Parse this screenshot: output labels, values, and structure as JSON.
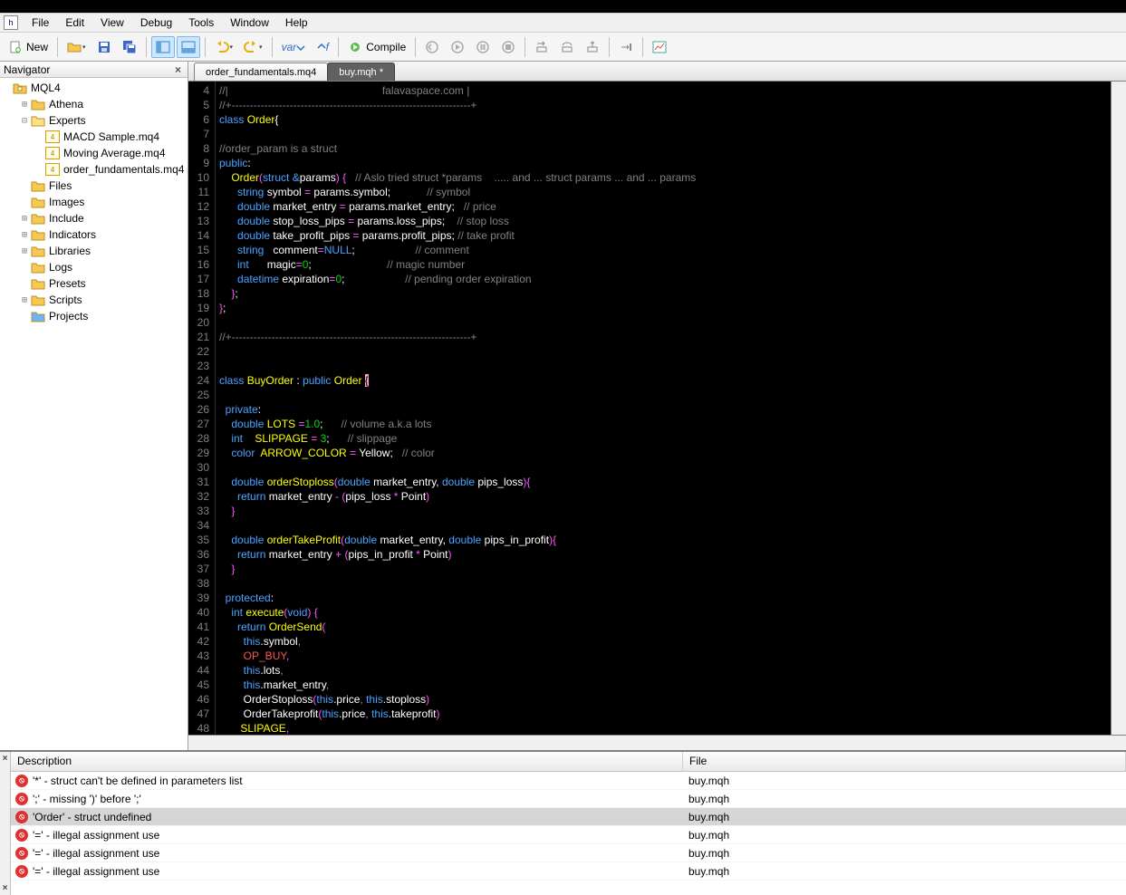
{
  "menu": {
    "items": [
      "File",
      "Edit",
      "View",
      "Debug",
      "Tools",
      "Window",
      "Help"
    ]
  },
  "toolbar": {
    "new_label": "New",
    "compile_label": "Compile",
    "var_label": "var",
    "f_label": "f"
  },
  "navigator": {
    "title": "Navigator",
    "root": "MQL4",
    "nodes": [
      {
        "label": "Athena",
        "depth": 1,
        "expander": "+",
        "icon": "folder"
      },
      {
        "label": "Experts",
        "depth": 1,
        "expander": "-",
        "icon": "folder-open"
      },
      {
        "label": "MACD Sample.mq4",
        "depth": 2,
        "expander": "",
        "icon": "mq4"
      },
      {
        "label": "Moving Average.mq4",
        "depth": 2,
        "expander": "",
        "icon": "mq4"
      },
      {
        "label": "order_fundamentals.mq4",
        "depth": 2,
        "expander": "",
        "icon": "mq4"
      },
      {
        "label": "Files",
        "depth": 1,
        "expander": "",
        "icon": "folder"
      },
      {
        "label": "Images",
        "depth": 1,
        "expander": "",
        "icon": "folder"
      },
      {
        "label": "Include",
        "depth": 1,
        "expander": "+",
        "icon": "folder"
      },
      {
        "label": "Indicators",
        "depth": 1,
        "expander": "+",
        "icon": "folder"
      },
      {
        "label": "Libraries",
        "depth": 1,
        "expander": "+",
        "icon": "folder"
      },
      {
        "label": "Logs",
        "depth": 1,
        "expander": "",
        "icon": "folder"
      },
      {
        "label": "Presets",
        "depth": 1,
        "expander": "",
        "icon": "folder"
      },
      {
        "label": "Scripts",
        "depth": 1,
        "expander": "+",
        "icon": "folder"
      },
      {
        "label": "Projects",
        "depth": 1,
        "expander": "",
        "icon": "folder-blue"
      }
    ]
  },
  "tabs": [
    {
      "label": "order_fundamentals.mq4",
      "active": false
    },
    {
      "label": "buy.mqh *",
      "active": true
    }
  ],
  "gutter_start": 4,
  "gutter_end": 48,
  "code_lines": [
    [
      [
        "gray",
        "//|                                                   falavaspace.com |"
      ]
    ],
    [
      [
        "gray",
        "//+------------------------------------------------------------------+"
      ]
    ],
    [
      [
        "blue",
        "class"
      ],
      [
        "white",
        " "
      ],
      [
        "yellow",
        "Order"
      ],
      [
        "white",
        "{"
      ]
    ],
    [],
    [
      [
        "gray",
        "//order_param is a struct"
      ]
    ],
    [
      [
        "blue",
        "public"
      ],
      [
        "white",
        ":"
      ]
    ],
    [
      [
        "white",
        "    "
      ],
      [
        "yellow",
        "Order"
      ],
      [
        "magenta",
        "("
      ],
      [
        "blue",
        "struct"
      ],
      [
        "white",
        " "
      ],
      [
        "blue",
        "&"
      ],
      [
        "white",
        "params"
      ],
      [
        "magenta",
        ")"
      ],
      [
        "white",
        " "
      ],
      [
        "magenta",
        "{"
      ],
      [
        "white",
        "   "
      ],
      [
        "gray",
        "// Aslo tried struct *params    ..... and ... struct params ... and ... params"
      ]
    ],
    [
      [
        "white",
        "      "
      ],
      [
        "blue",
        "string"
      ],
      [
        "white",
        " symbol "
      ],
      [
        "magenta",
        "="
      ],
      [
        "white",
        " params.symbol;            "
      ],
      [
        "gray",
        "// symbol"
      ]
    ],
    [
      [
        "white",
        "      "
      ],
      [
        "blue",
        "double"
      ],
      [
        "white",
        " market_entry "
      ],
      [
        "magenta",
        "="
      ],
      [
        "white",
        " params.market_entry;   "
      ],
      [
        "gray",
        "// price"
      ]
    ],
    [
      [
        "white",
        "      "
      ],
      [
        "blue",
        "double"
      ],
      [
        "white",
        " stop_loss_pips "
      ],
      [
        "magenta",
        "="
      ],
      [
        "white",
        " params.loss_pips;    "
      ],
      [
        "gray",
        "// stop loss"
      ]
    ],
    [
      [
        "white",
        "      "
      ],
      [
        "blue",
        "double"
      ],
      [
        "white",
        " take_profit_pips "
      ],
      [
        "magenta",
        "="
      ],
      [
        "white",
        " params.profit_pips; "
      ],
      [
        "gray",
        "// take profit"
      ]
    ],
    [
      [
        "white",
        "      "
      ],
      [
        "blue",
        "string"
      ],
      [
        "white",
        "   comment"
      ],
      [
        "magenta",
        "="
      ],
      [
        "blue",
        "NULL"
      ],
      [
        "white",
        ";                    "
      ],
      [
        "gray",
        "// comment"
      ]
    ],
    [
      [
        "white",
        "      "
      ],
      [
        "blue",
        "int"
      ],
      [
        "white",
        "      magic"
      ],
      [
        "magenta",
        "="
      ],
      [
        "green",
        "0"
      ],
      [
        "white",
        ";                         "
      ],
      [
        "gray",
        "// magic number"
      ]
    ],
    [
      [
        "white",
        "      "
      ],
      [
        "blue",
        "datetime"
      ],
      [
        "white",
        " expiration"
      ],
      [
        "magenta",
        "="
      ],
      [
        "green",
        "0"
      ],
      [
        "white",
        ";                    "
      ],
      [
        "gray",
        "// pending order expiration"
      ]
    ],
    [
      [
        "white",
        "    "
      ],
      [
        "magenta",
        "}"
      ],
      [
        "white",
        ";"
      ]
    ],
    [
      [
        "magenta",
        "}"
      ],
      [
        "white",
        ";"
      ]
    ],
    [],
    [
      [
        "gray",
        "//+------------------------------------------------------------------+"
      ]
    ],
    [],
    [],
    [
      [
        "blue",
        "class"
      ],
      [
        "white",
        " "
      ],
      [
        "yellow",
        "BuyOrder"
      ],
      [
        "white",
        " : "
      ],
      [
        "blue",
        "public"
      ],
      [
        "white",
        " "
      ],
      [
        "yellow",
        "Order"
      ],
      [
        "white",
        " "
      ],
      [
        "cursor",
        "{"
      ]
    ],
    [],
    [
      [
        "white",
        "  "
      ],
      [
        "blue",
        "private"
      ],
      [
        "white",
        ":"
      ]
    ],
    [
      [
        "white",
        "    "
      ],
      [
        "blue",
        "double"
      ],
      [
        "white",
        " "
      ],
      [
        "yellow",
        "LOTS"
      ],
      [
        "white",
        " "
      ],
      [
        "magenta",
        "="
      ],
      [
        "green",
        "1.0"
      ],
      [
        "white",
        ";      "
      ],
      [
        "gray",
        "// volume a.k.a lots"
      ]
    ],
    [
      [
        "white",
        "    "
      ],
      [
        "blue",
        "int"
      ],
      [
        "white",
        "    "
      ],
      [
        "yellow",
        "SLIPPAGE"
      ],
      [
        "white",
        " "
      ],
      [
        "magenta",
        "="
      ],
      [
        "white",
        " "
      ],
      [
        "green",
        "3"
      ],
      [
        "white",
        ";      "
      ],
      [
        "gray",
        "// slippage"
      ]
    ],
    [
      [
        "white",
        "    "
      ],
      [
        "blue",
        "color"
      ],
      [
        "white",
        "  "
      ],
      [
        "yellow",
        "ARROW_COLOR"
      ],
      [
        "white",
        " "
      ],
      [
        "magenta",
        "="
      ],
      [
        "white",
        " Yellow;   "
      ],
      [
        "gray",
        "// color"
      ]
    ],
    [],
    [
      [
        "white",
        "    "
      ],
      [
        "blue",
        "double"
      ],
      [
        "white",
        " "
      ],
      [
        "yellow",
        "orderStoploss"
      ],
      [
        "magenta",
        "("
      ],
      [
        "blue",
        "double"
      ],
      [
        "white",
        " market_entry, "
      ],
      [
        "blue",
        "double"
      ],
      [
        "white",
        " pips_loss"
      ],
      [
        "magenta",
        ")"
      ],
      [
        "magenta",
        "{"
      ]
    ],
    [
      [
        "white",
        "      "
      ],
      [
        "blue",
        "return"
      ],
      [
        "white",
        " market_entry "
      ],
      [
        "magenta",
        "-"
      ],
      [
        "white",
        " "
      ],
      [
        "magenta",
        "("
      ],
      [
        "white",
        "pips_loss "
      ],
      [
        "magenta",
        "*"
      ],
      [
        "white",
        " Point"
      ],
      [
        "magenta",
        ")"
      ]
    ],
    [
      [
        "white",
        "    "
      ],
      [
        "magenta",
        "}"
      ]
    ],
    [],
    [
      [
        "white",
        "    "
      ],
      [
        "blue",
        "double"
      ],
      [
        "white",
        " "
      ],
      [
        "yellow",
        "orderTakeProfit"
      ],
      [
        "magenta",
        "("
      ],
      [
        "blue",
        "double"
      ],
      [
        "white",
        " market_entry, "
      ],
      [
        "blue",
        "double"
      ],
      [
        "white",
        " pips_in_profit"
      ],
      [
        "magenta",
        ")"
      ],
      [
        "magenta",
        "{"
      ]
    ],
    [
      [
        "white",
        "      "
      ],
      [
        "blue",
        "return"
      ],
      [
        "white",
        " market_entry "
      ],
      [
        "magenta",
        "+"
      ],
      [
        "white",
        " "
      ],
      [
        "magenta",
        "("
      ],
      [
        "white",
        "pips_in_profit "
      ],
      [
        "magenta",
        "*"
      ],
      [
        "white",
        " Point"
      ],
      [
        "magenta",
        ")"
      ]
    ],
    [
      [
        "white",
        "    "
      ],
      [
        "magenta",
        "}"
      ]
    ],
    [],
    [
      [
        "white",
        "  "
      ],
      [
        "blue",
        "protected"
      ],
      [
        "white",
        ":"
      ]
    ],
    [
      [
        "white",
        "    "
      ],
      [
        "blue",
        "int"
      ],
      [
        "white",
        " "
      ],
      [
        "yellow",
        "execute"
      ],
      [
        "magenta",
        "("
      ],
      [
        "blue",
        "void"
      ],
      [
        "magenta",
        ")"
      ],
      [
        "white",
        " "
      ],
      [
        "magenta",
        "{"
      ]
    ],
    [
      [
        "white",
        "      "
      ],
      [
        "blue",
        "return"
      ],
      [
        "white",
        " "
      ],
      [
        "yellow",
        "OrderSend"
      ],
      [
        "magenta",
        "("
      ]
    ],
    [
      [
        "white",
        "        "
      ],
      [
        "blue",
        "this"
      ],
      [
        "white",
        ".symbol"
      ],
      [
        "magenta",
        ","
      ]
    ],
    [
      [
        "white",
        "        "
      ],
      [
        "red",
        "OP_BUY"
      ],
      [
        "magenta",
        ","
      ]
    ],
    [
      [
        "white",
        "        "
      ],
      [
        "blue",
        "this"
      ],
      [
        "white",
        ".lots"
      ],
      [
        "magenta",
        ","
      ]
    ],
    [
      [
        "white",
        "        "
      ],
      [
        "blue",
        "this"
      ],
      [
        "white",
        ".market_entry"
      ],
      [
        "magenta",
        ","
      ]
    ],
    [
      [
        "white",
        "        OrderStoploss"
      ],
      [
        "magenta",
        "("
      ],
      [
        "blue",
        "this"
      ],
      [
        "white",
        ".price"
      ],
      [
        "magenta",
        ","
      ],
      [
        "white",
        " "
      ],
      [
        "blue",
        "this"
      ],
      [
        "white",
        ".stoploss"
      ],
      [
        "magenta",
        ")"
      ]
    ],
    [
      [
        "white",
        "        OrderTakeprofit"
      ],
      [
        "magenta",
        "("
      ],
      [
        "blue",
        "this"
      ],
      [
        "white",
        ".price"
      ],
      [
        "magenta",
        ","
      ],
      [
        "white",
        " "
      ],
      [
        "blue",
        "this"
      ],
      [
        "white",
        ".takeprofit"
      ],
      [
        "magenta",
        ")"
      ]
    ],
    [
      [
        "white",
        "       "
      ],
      [
        "yellow",
        "SLIPAGE"
      ],
      [
        "magenta",
        ","
      ]
    ]
  ],
  "errors": {
    "columns": {
      "description": "Description",
      "file": "File"
    },
    "rows": [
      {
        "desc": "'*' - struct can't be defined in parameters list",
        "file": "buy.mqh",
        "sel": false
      },
      {
        "desc": "';' - missing ')' before ';'",
        "file": "buy.mqh",
        "sel": false
      },
      {
        "desc": "'Order' - struct undefined",
        "file": "buy.mqh",
        "sel": true
      },
      {
        "desc": "'=' - illegal assignment use",
        "file": "buy.mqh",
        "sel": false
      },
      {
        "desc": "'=' - illegal assignment use",
        "file": "buy.mqh",
        "sel": false
      },
      {
        "desc": "'=' - illegal assignment use",
        "file": "buy.mqh",
        "sel": false
      }
    ]
  }
}
